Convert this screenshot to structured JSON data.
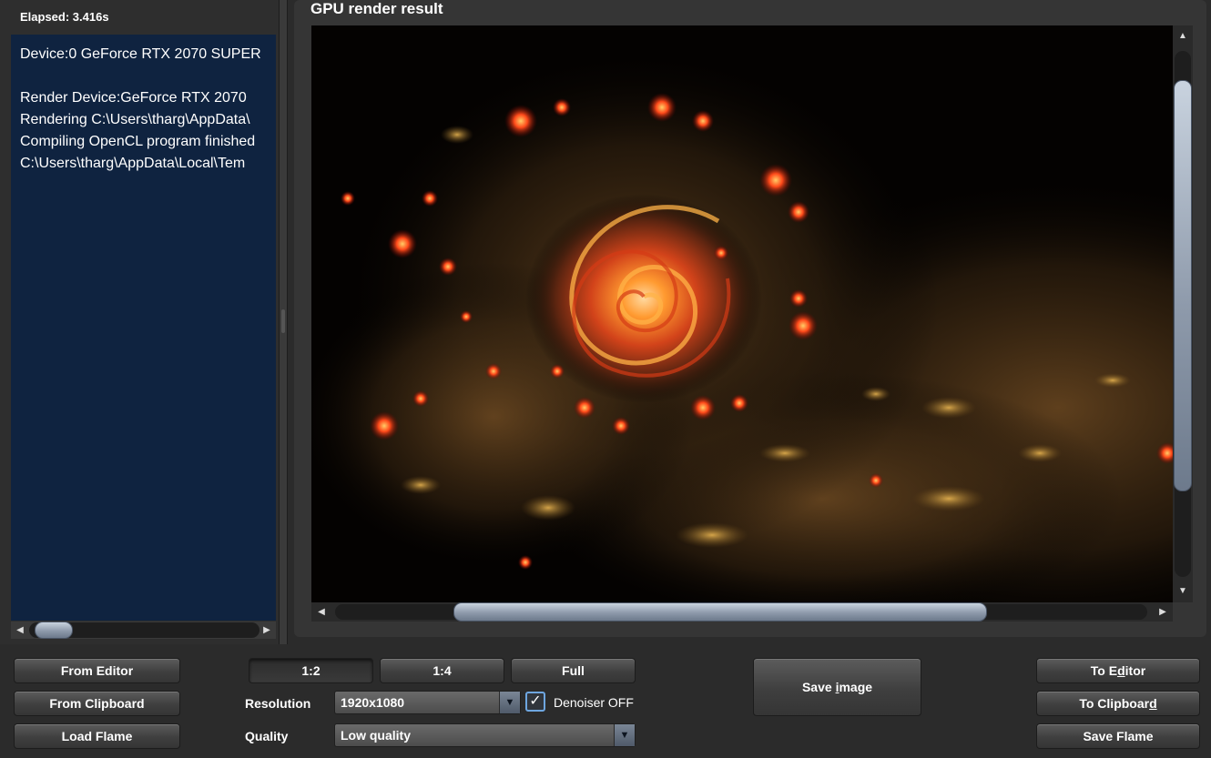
{
  "status": {
    "elapsed": "Elapsed: 3.416s"
  },
  "log": {
    "lines": [
      "Device:0  GeForce RTX 2070 SUPER",
      "",
      "Render Device:GeForce RTX 2070",
      "Rendering C:\\Users\\tharg\\AppData\\",
      "Compiling OpenCL program finished",
      "C:\\Users\\tharg\\AppData\\Local\\Tem"
    ]
  },
  "panel": {
    "title": "GPU render result"
  },
  "left_buttons": {
    "from_editor": "From Editor",
    "from_clipboard": "From Clipboard",
    "load_flame": "Load Flame"
  },
  "scale_buttons": {
    "half": "1:2",
    "quarter": "1:4",
    "full": "Full",
    "selected": "1:2"
  },
  "resolution": {
    "label": "Resolution",
    "value": "1920x1080"
  },
  "denoiser": {
    "checked": true,
    "label": "Denoiser OFF"
  },
  "quality": {
    "label": "Quality",
    "value": "Low quality"
  },
  "save_image": {
    "prefix": "Save ",
    "mnemonic": "i",
    "suffix": "mage"
  },
  "right_buttons": {
    "to_editor": {
      "prefix": "To E",
      "mnemonic": "d",
      "suffix": "itor"
    },
    "to_clipboard": {
      "prefix": "To Clipboar",
      "mnemonic": "d",
      "suffix": ""
    },
    "save_flame": "Save Flame"
  },
  "icons": {
    "arrow_up": "scroll-up-arrow",
    "arrow_down": "scroll-down-arrow",
    "arrow_left": "scroll-left-arrow",
    "arrow_right": "scroll-right-arrow",
    "combo_dropdown": "chevron-down-icon",
    "check": "checkmark-icon"
  },
  "colors": {
    "log_background": "#0f2340",
    "app_background": "#2b2b2b",
    "checkbox_border": "#6ea6e0"
  }
}
